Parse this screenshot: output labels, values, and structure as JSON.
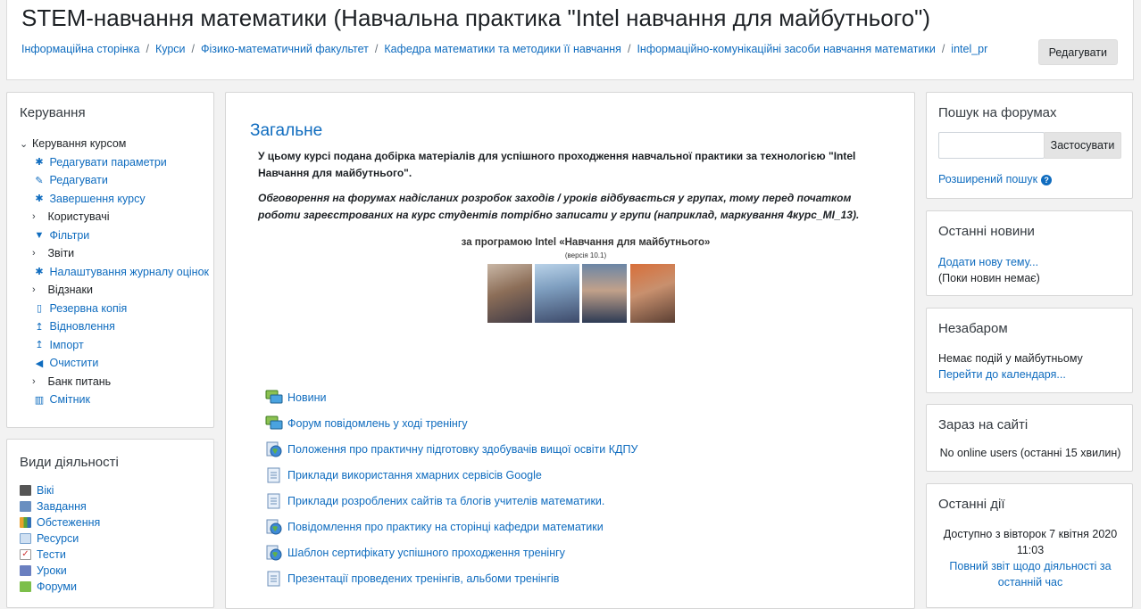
{
  "header": {
    "title": "STEM-навчання математики (Навчальна практика \"Intel навчання для майбутнього\")",
    "breadcrumb": [
      "Інформаційна сторінка",
      "Курси",
      "Фізико-математичний факультет",
      "Кафедра математики та методики її навчання",
      "Інформаційно-комунікаційні засоби навчання математики",
      "intel_pr"
    ],
    "edit_label": "Редагувати"
  },
  "admin": {
    "title": "Керування",
    "course_admin": "Керування курсом",
    "items": [
      {
        "label": "Редагувати параметри",
        "icon": "gear-icon"
      },
      {
        "label": "Редагувати",
        "icon": "pencil-icon"
      },
      {
        "label": "Завершення курсу",
        "icon": "gear-icon"
      },
      {
        "label": "Користувачі",
        "icon": "chevron-right-icon"
      },
      {
        "label": "Фільтри",
        "icon": "filter-icon"
      },
      {
        "label": "Звіти",
        "icon": "chevron-right-icon"
      },
      {
        "label": "Налаштування журналу оцінок",
        "icon": "gear-icon"
      },
      {
        "label": "Відзнаки",
        "icon": "chevron-right-icon"
      },
      {
        "label": "Резервна копія",
        "icon": "file-icon"
      },
      {
        "label": "Відновлення",
        "icon": "upload-icon"
      },
      {
        "label": "Імпорт",
        "icon": "upload-icon"
      },
      {
        "label": "Очистити",
        "icon": "arrow-left-icon"
      },
      {
        "label": "Банк питань",
        "icon": "chevron-right-icon"
      },
      {
        "label": "Смітник",
        "icon": "trash-icon"
      }
    ]
  },
  "activities_block": {
    "title": "Види діяльності",
    "items": [
      {
        "label": "Вікі",
        "icon": "wiki-icon"
      },
      {
        "label": "Завдання",
        "icon": "assignment-icon"
      },
      {
        "label": "Обстеження",
        "icon": "survey-icon"
      },
      {
        "label": "Ресурси",
        "icon": "resource-icon"
      },
      {
        "label": "Тести",
        "icon": "quiz-icon"
      },
      {
        "label": "Уроки",
        "icon": "lesson-icon"
      },
      {
        "label": "Форуми",
        "icon": "forum-icon"
      }
    ]
  },
  "main": {
    "section_title": "Загальне",
    "summary": "У цьому курсі подана добірка матеріалів для успішного проходження навчальної практики за технологією \"Intel Навчання для майбутнього\".",
    "discussion": "Обговорення на форумах надісланих розробок заходів / уроків відбувається у групах, тому перед початком роботи зареєстрованих на курс студентів потрібно записати у групи (наприклад, маркування 4курс_МІ_13).",
    "banner_title": "за програмою Intel «Навчання для майбутнього»",
    "banner_version": "(версія 10.1)",
    "activities": [
      {
        "label": "Новини",
        "icon": "forum-icon"
      },
      {
        "label": "Форум повідомлень у ході тренінгу",
        "icon": "forum-icon"
      },
      {
        "label": "Положення про практичну підготовку здобувачів вищої освіти КДПУ",
        "icon": "url-icon"
      },
      {
        "label": "Приклади використання хмарних сервісів Google",
        "icon": "page-icon"
      },
      {
        "label": "Приклади розроблених сайтів та блогів учителів математики.",
        "icon": "page-icon"
      },
      {
        "label": "Повідомлення про практику на сторінці кафедри математики",
        "icon": "url-icon"
      },
      {
        "label": "Шаблон сертифікату успішного проходження тренінгу",
        "icon": "url-icon"
      },
      {
        "label": "Презентації проведених тренінгів, альбоми тренінгів",
        "icon": "page-icon"
      }
    ]
  },
  "search_forums": {
    "title": "Пошук на форумах",
    "value": "",
    "button": "Застосувати",
    "advanced": "Розширений пошук"
  },
  "latest_news": {
    "title": "Останні новини",
    "add": "Додати нову тему...",
    "empty": "(Поки новин немає)"
  },
  "upcoming": {
    "title": "Незабаром",
    "empty": "Немає подій у майбутньому",
    "calendar": "Перейти до календаря..."
  },
  "online": {
    "title": "Зараз на сайті",
    "text": "No online users (останні 15 хвилин)"
  },
  "recent": {
    "title": "Останні дії",
    "since_line1": "Доступно з вівторок 7 квітня 2020",
    "since_line2": "11:03",
    "report_line1": "Повний звіт щодо діяльності за",
    "report_line2": "останній час"
  },
  "colors": {
    "link": "#0f6cbf",
    "background": "#f2f2f2"
  }
}
